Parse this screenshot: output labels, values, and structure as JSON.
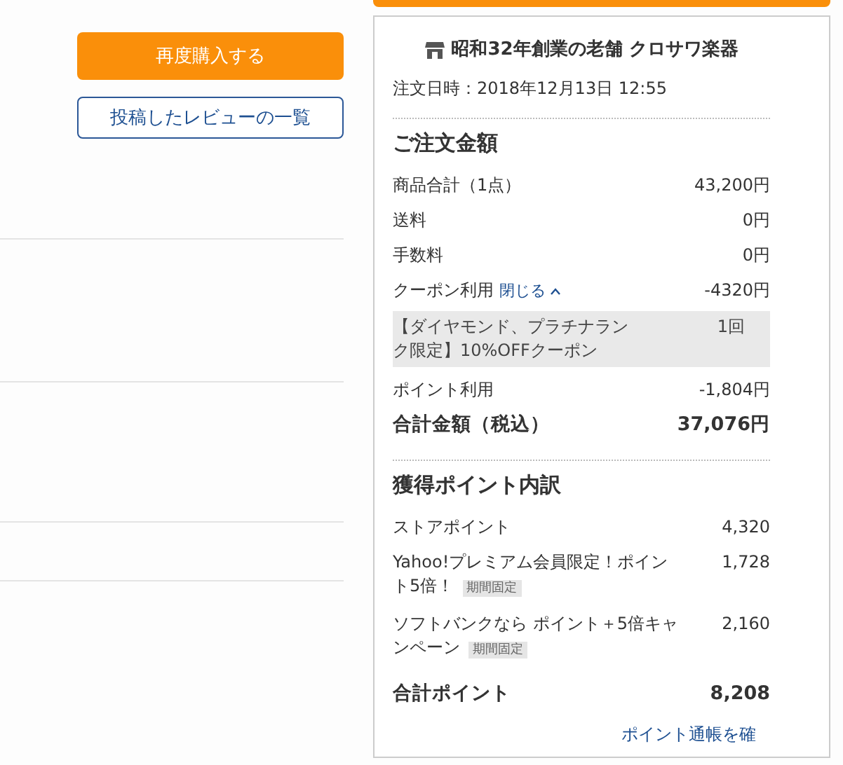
{
  "actions": [
    {
      "kind": "primary",
      "label": "再度購入する"
    },
    {
      "kind": "outline",
      "label": "投稿したレビューの一覧"
    }
  ],
  "store": {
    "name": "昭和32年創業の老舗 クロサワ楽器",
    "order_date": "注文日時：2018年12月13日 12:55"
  },
  "amount": {
    "heading": "ご注文金額",
    "rows": [
      {
        "kind": "plain",
        "label": "商品合計（1点）",
        "value": "43,200円"
      },
      {
        "kind": "plain",
        "label": "送料",
        "value": "0円"
      },
      {
        "kind": "plain",
        "label": "手数料",
        "value": "0円"
      },
      {
        "kind": "coupon",
        "label": "クーポン利用",
        "toggle": "閉じる",
        "expanded": true,
        "value": "-4320円",
        "coupons": [
          {
            "name": "【ダイヤモンド、プラチナランク限定】10%OFFクーポン",
            "count": "1回"
          }
        ]
      },
      {
        "kind": "plain",
        "label": "ポイント利用",
        "value": "-1,804円"
      },
      {
        "kind": "total",
        "label": "合計金額（税込）",
        "value": "37,076円"
      }
    ]
  },
  "points": {
    "heading": "獲得ポイント内訳",
    "rows": [
      {
        "kind": "plain",
        "label": "ストアポイント",
        "value": "4,320"
      },
      {
        "kind": "plain",
        "label": "Yahoo!プレミアム会員限定！ポイント5倍！",
        "tag": "期間固定",
        "value": "1,728"
      },
      {
        "kind": "plain",
        "label": "ソフトバンクなら ポイント＋5倍キャンペーン",
        "tag": "期間固定",
        "value": "2,160"
      },
      {
        "kind": "total",
        "label": "合計ポイント",
        "value": "8,208"
      }
    ],
    "link": "ポイント通帳を確"
  }
}
